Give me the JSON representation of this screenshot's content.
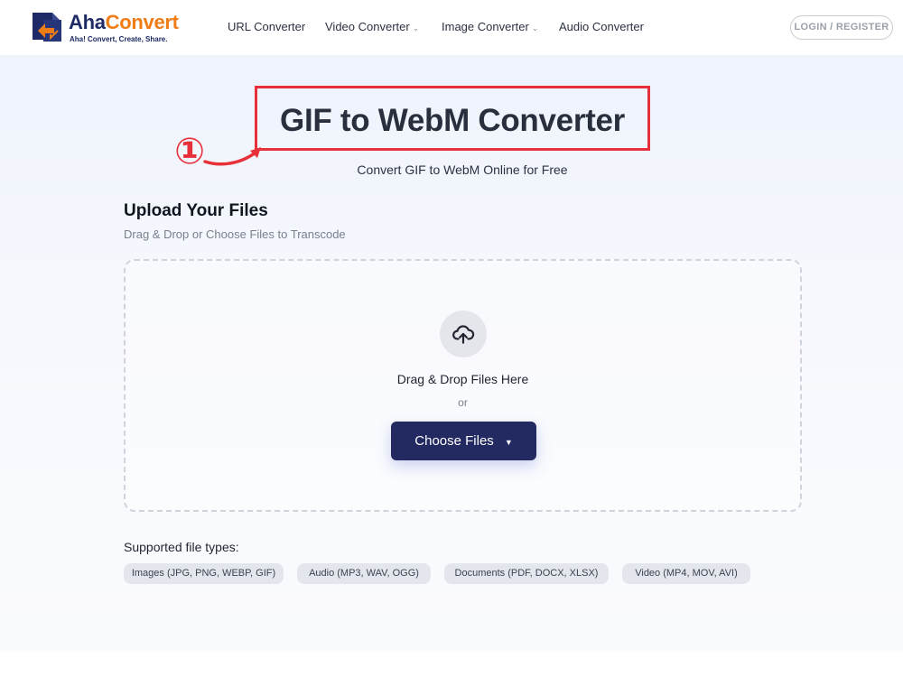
{
  "header": {
    "logo": {
      "name_part1": "Aha",
      "name_part2": "Convert",
      "tagline": "Aha! Convert, Create, Share."
    },
    "nav": [
      {
        "label": "URL Converter",
        "has_dropdown": false
      },
      {
        "label": "Video Converter",
        "has_dropdown": true
      },
      {
        "label": "Image Converter",
        "has_dropdown": true
      },
      {
        "label": "Audio Converter",
        "has_dropdown": false
      }
    ],
    "login_label": "LOGIN / REGISTER",
    "chevron_glyph": "⌄"
  },
  "hero": {
    "title": "GIF to WebM Converter",
    "step_badge": "①",
    "subtitle": "Convert GIF to WebM Online for Free"
  },
  "upload": {
    "title": "Upload Your Files",
    "subtitle": "Drag & Drop or Choose Files to Transcode",
    "drop_label": "Drag & Drop Files Here",
    "or_label": "or",
    "choose_label": "Choose Files",
    "caret_glyph": "▼"
  },
  "supported": {
    "label": "Supported file types:",
    "types": [
      "Images (JPG, PNG, WEBP, GIF)",
      "Audio (MP3, WAV, OGG)",
      "Documents (PDF, DOCX, XLSX)",
      "Video (MP4, MOV, AVI)"
    ]
  },
  "colors": {
    "brand_navy": "#1d2a66",
    "brand_orange": "#f07c16",
    "annotation_red": "#e8303a",
    "button_bg": "#232a62"
  }
}
